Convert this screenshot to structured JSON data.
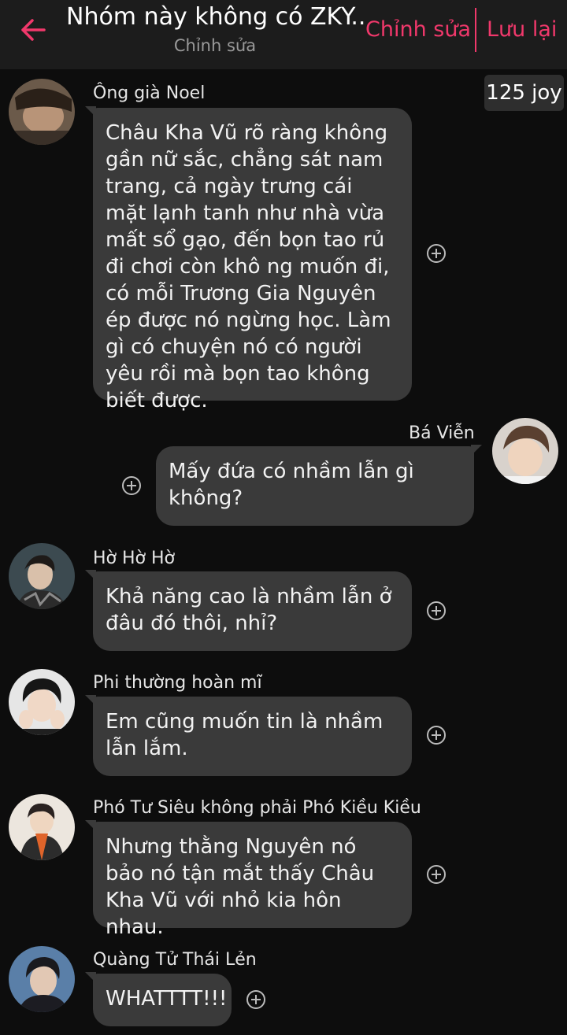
{
  "header": {
    "title": "Nhóm này không có ZKY...",
    "subtitle": "Chỉnh sửa",
    "edit_label": "Chỉnh sửa",
    "save_label": "Lưu lại"
  },
  "joy_badge": "125 joy",
  "colors": {
    "accent": "#f0386b",
    "background": "#0d0d0d",
    "header_bg": "#1c1c1c",
    "bubble_bg": "#3a3a3a"
  },
  "messages": [
    {
      "sender": "Ông già Noel",
      "side": "left",
      "text": "Châu Kha Vũ rõ ràng không gần nữ sắc, chẳng sát nam trang, cả ngày trưng cái mặt lạnh tanh như nhà vừa mất sổ gạo, đến bọn tao rủ đi chơi còn khô ng muốn đi, có mỗi Trương Gia Nguyên ép được nó ngừng học. Làm gì có chuyện nó  có người yêu rồi mà bọn tao không biết được."
    },
    {
      "sender": "Bá Viễn",
      "side": "right",
      "text": "Mấy đứa có nhầm lẫn gì không?"
    },
    {
      "sender": "Hờ Hờ Hờ",
      "side": "left",
      "text": "Khả năng cao là nhầm lẫn ở đâu đó thôi, nhỉ?"
    },
    {
      "sender": "Phi thường hoàn mĩ",
      "side": "left",
      "text": "Em cũng muốn tin là nhầm lẫn lắm."
    },
    {
      "sender": "Phó Tư Siêu không phải Phó Kiều Kiều",
      "side": "left",
      "text": "Nhưng thằng Nguyên nó bảo nó tận mắt thấy Châu Kha Vũ với nhỏ kia hôn nhau."
    },
    {
      "sender": "Quàng Tử Thái Lẻn",
      "side": "left",
      "text": "WHATTTT!!!"
    }
  ]
}
